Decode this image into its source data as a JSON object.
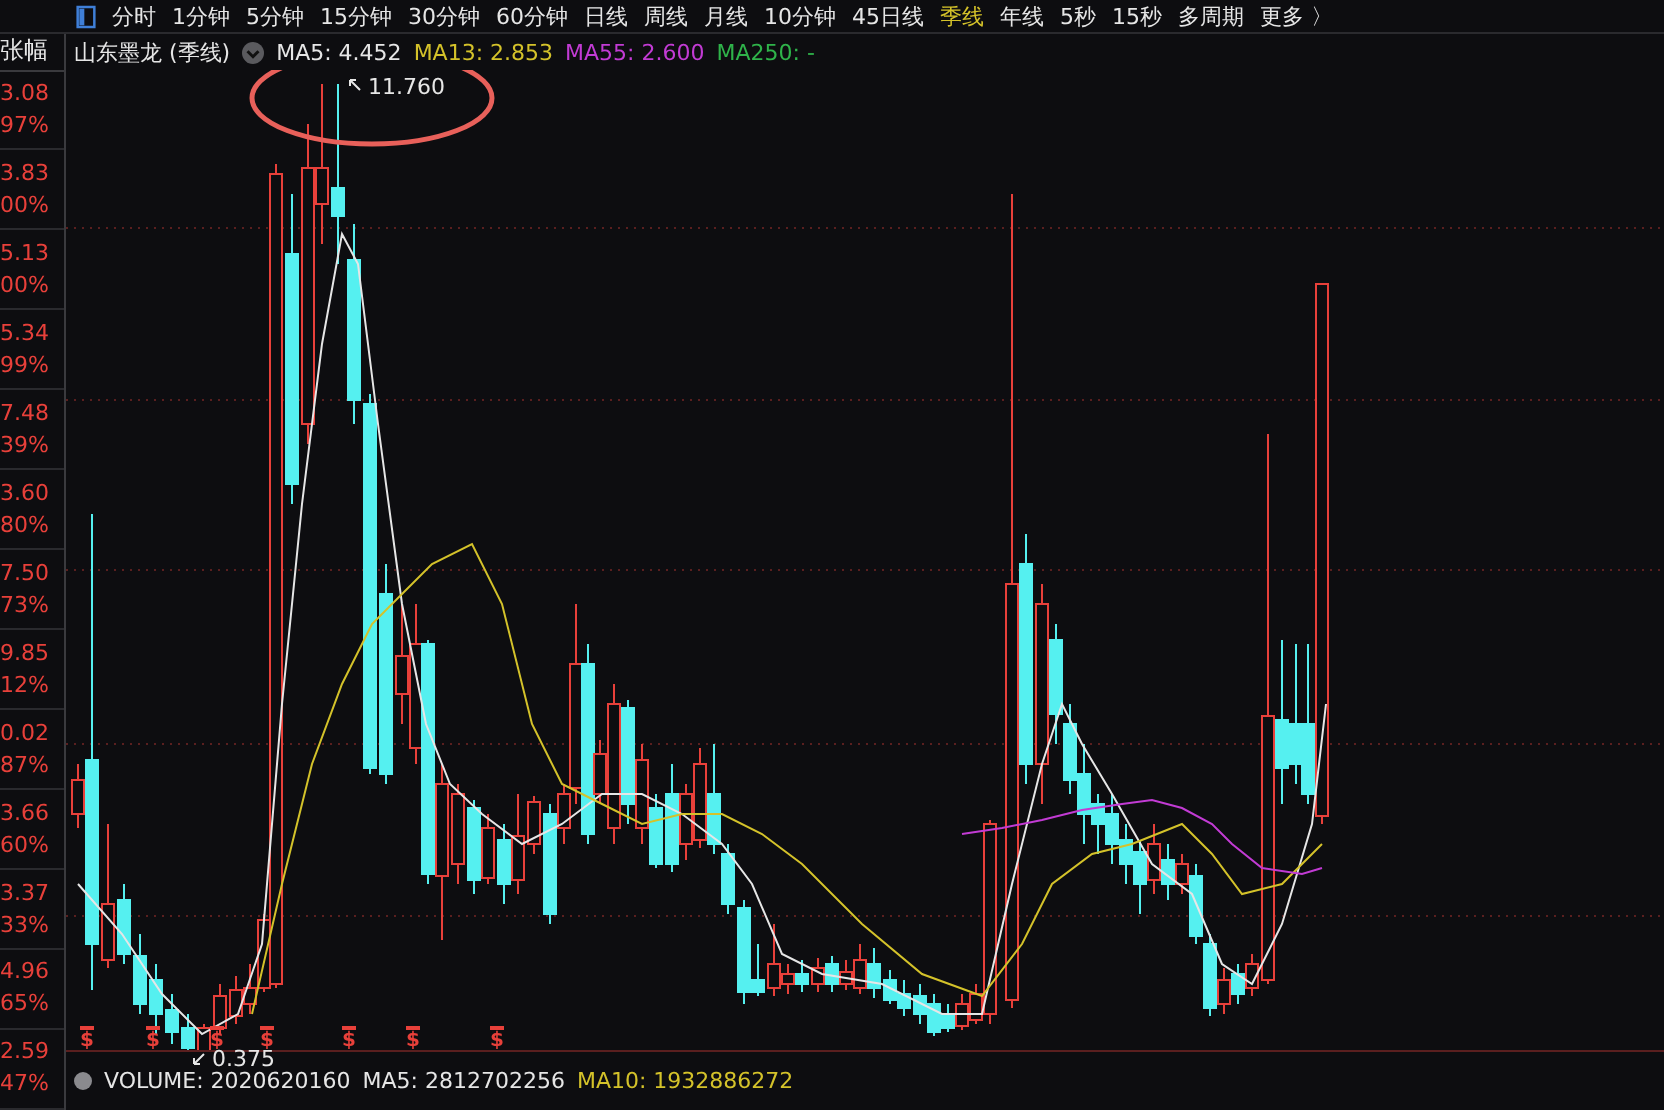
{
  "tabs": [
    {
      "label": "分时",
      "selected": false
    },
    {
      "label": "1分钟",
      "selected": false
    },
    {
      "label": "5分钟",
      "selected": false
    },
    {
      "label": "15分钟",
      "selected": false
    },
    {
      "label": "30分钟",
      "selected": false
    },
    {
      "label": "60分钟",
      "selected": false
    },
    {
      "label": "日线",
      "selected": false
    },
    {
      "label": "周线",
      "selected": false
    },
    {
      "label": "月线",
      "selected": false
    },
    {
      "label": "10分钟",
      "selected": false
    },
    {
      "label": "45日线",
      "selected": false
    },
    {
      "label": "季线",
      "selected": true
    },
    {
      "label": "年线",
      "selected": false
    },
    {
      "label": "5秒",
      "selected": false
    },
    {
      "label": "15秒",
      "selected": false
    },
    {
      "label": "多周期",
      "selected": false
    },
    {
      "label": "更多 〉",
      "selected": false
    }
  ],
  "axis_header": "张幅",
  "chart_header": {
    "title": "山东墨龙 (季线)",
    "indicators": [
      {
        "text": "MA5: 4.452",
        "color": "#e6e6e6"
      },
      {
        "text": "MA13: 2.853",
        "color": "#d4c22a"
      },
      {
        "text": "MA55: 2.600",
        "color": "#c23bd4"
      },
      {
        "text": "MA250: -",
        "color": "#2fb34a"
      }
    ]
  },
  "axis_labels": [
    {
      "price": "3.08",
      "pct": "97%"
    },
    {
      "price": "3.83",
      "pct": "00%"
    },
    {
      "price": "5.13",
      "pct": "00%"
    },
    {
      "price": "5.34",
      "pct": "99%"
    },
    {
      "price": "7.48",
      "pct": "39%"
    },
    {
      "price": "3.60",
      "pct": "80%"
    },
    {
      "price": "7.50",
      "pct": "73%"
    },
    {
      "price": "9.85",
      "pct": "12%"
    },
    {
      "price": "0.02",
      "pct": "87%"
    },
    {
      "price": "3.66",
      "pct": "60%"
    },
    {
      "price": "3.37",
      "pct": "33%"
    },
    {
      "price": "4.96",
      "pct": "65%"
    },
    {
      "price": "2.59",
      "pct": "47%"
    }
  ],
  "high_label": "11.760",
  "low_label": "0.375",
  "markers": [
    "$",
    "$",
    "$",
    "$",
    "$",
    "$",
    "$"
  ],
  "volume": [
    {
      "text": "VOLUME: 2020620160",
      "color": "#e6e6e6"
    },
    {
      "text": "MA5: 2812702256",
      "color": "#e6e6e6"
    },
    {
      "text": "MA10: 1932886272",
      "color": "#d4c22a"
    }
  ]
}
